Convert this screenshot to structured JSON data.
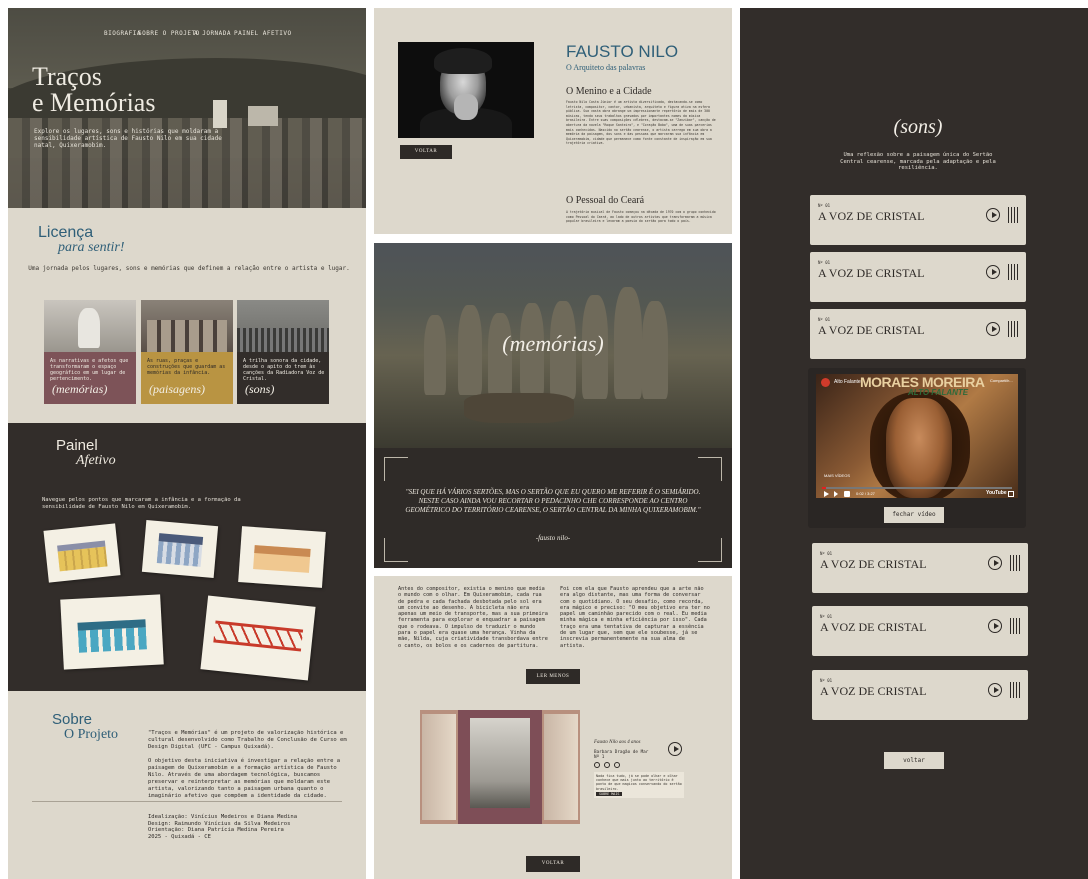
{
  "panel1": {
    "nav": [
      "BIOGRAFIA",
      "SOBRE O PROJETO",
      "A JORNADA",
      "PAINEL AFETIVO"
    ],
    "hero": {
      "title_line1": "Traços",
      "title_line2": "e Memórias",
      "subtitle": "Explore os lugares, sons e histórias que moldaram a sensibilidade artística de Fausto Nilo em sua cidade natal, Quixeramobim."
    },
    "licenca": {
      "title": "Licença",
      "subtitle": "para sentir!",
      "description": "Uma jornada pelos lugares, sons e memórias que definem a relação entre o artista e lugar."
    },
    "cards": [
      {
        "text": "As narrativas e afetos que transformaram o espaço geográfico em um lugar de pertencimento.",
        "label": "(memórias)",
        "color": "#7d5358"
      },
      {
        "text": "As ruas, praças e construções que guardam as memórias da infância.",
        "label": "(paisagens)",
        "color": "#b99442"
      },
      {
        "text": "A trilha sonora da cidade, desde o apito do trem às canções da Radiadora Voz de Cristal.",
        "label": "(sons)",
        "color": "#322d2a"
      }
    ],
    "painel": {
      "title": "Painel",
      "subtitle": "Afetivo",
      "description": "Navegue pelos pontos que marcaram a infância e a formação da sensibilidade de Fausto Nilo em Quixeramobim."
    },
    "sobre": {
      "title": "Sobre",
      "subtitle": "O Projeto",
      "paragraph1": "\"Traços e Memórias\" é um projeto de valorização histórica e cultural desenvolvido como Trabalho de Conclusão de Curso em Design Digital (UFC - Campus Quixadá).",
      "paragraph2": "O objetivo desta iniciativa é investigar a relação entre a paisagem de Quixeramobim e a formação artística de Fausto Nilo. Através de uma abordagem tecnológica, buscamos preservar e reinterpretar as memórias que moldaram este artista, valorizando tanto a paisagem urbana quanto o imaginário afetivo que compõem a identidade da cidade."
    },
    "credits": {
      "line1": "Idealização: Vinícius Medeiros e Diana Medina",
      "line2": "Design: Raimundo Vinícius da Silva Medeiros",
      "line3": "Orientação: Diana Patrícia Medina Pereira",
      "line4": "2025 - Quixadá - CE"
    }
  },
  "panel2": {
    "bio": {
      "name": "FAUSTO NILO",
      "role": "O Arquiteto das palavras",
      "back_label": "VOLTAR",
      "section1_title": "O Menino e a Cidade",
      "section1_text": "Fausto Nilo Costa Júnior é um artista diversificado, destacando-se como letrista, compositor, cantor, urbanista, arquiteto e figura ativa na esfera pública. Sua vasta obra abrange um impressionante repertório de mais de 300 músicas, tendo seus trabalhos gravados por importantes nomes da música brasileira. Entre suas composições célebres, destacam-se \"Zanzibar\", canção de abertura da novela \"Roque Santeiro\", e \"Coração Bobo\", uma de suas parcerias mais conhecidas. Nascido no sertão cearense, o artista carrega em sua obra a memória da paisagem, dos sons e das pessoas que marcaram sua infância em Quixeramobim, cidade que permanece como fonte constante de inspiração em sua trajetória criativa.",
      "section2_title": "O Pessoal do Ceará",
      "section2_text": "A trajetória musical de Fausto começou na década de 1970 com o grupo conhecido como Pessoal do Ceará, ao lado de outros artistas que transformaram a música popular brasileira e levaram a poesia do sertão para todo o país."
    },
    "memorias": {
      "title": "(memórias)",
      "quote": "\"SEI QUE HÁ VÁRIOS SERTÕES, MAS O SERTÃO QUE EU QUERO ME REFERIR É O SEMIÁRIDO. NESTE CASO AINDA VOU RECORTAR O PEDACINHO CHE CORRESPONDE AO CENTRO GEOMÉTRICO DO TERRITÓRIO CEARENSE, O SERTÃO CENTRAL DA MINHA QUIXERAMOBIM.\"",
      "author": "-fausto nilo-"
    },
    "texts": {
      "col1": "Antes do compositor, existia o menino que media o mundo com o olhar. Em Quixeramobim, cada rua de pedra e cada fachada desbotada pelo sol era um convite ao desenho. A bicicleta não era apenas um meio de transporte, mas a sua primeira ferramenta para explorar e enquadrar a paisagem que o rodeava. O impulso de traduzir o mundo para o papel era quase uma herança. Vinha da mãe, Nilda, cuja criatividade transbordava entre o canto, os bolos e os cadernos de partitura.",
      "col2": "Foi com ela que Fausto aprendeu que a arte não era algo distante, mas uma forma de conversar com o quotidiano. O seu desafio, como recorda, era mágico e preciso: \"O meu objetivo era ter no papel um caminhão parecido com o real. Eu media minha mágica e minha eficiência por isso\". Cada traço era uma tentativa de capturar a essência de um lugar que, sem que ele soubesse, já se inscrevia permanentemente na sua alma de artista.",
      "read_less": "LER MENOS",
      "back_label": "VOLTAR"
    },
    "player": {
      "title": "Fausto Nilo aos 4 anos",
      "subtitle": "Barbara Dragão de Mar",
      "track": "Nº 1",
      "note": "Nada fica tudo, já se pode olhar e olhar conhece que mais junto ao território é ponto de que magicos conservando do sertão brasileiro.",
      "note_button": "SOBRE MAIS"
    }
  },
  "panel3": {
    "title": "(sons)",
    "subtitle": "Uma reflexão sobre a paisagem única do Sertão Central cearense, marcada pela adaptação e pela resiliência.",
    "tracks": [
      {
        "number": "Nº 01",
        "name": "A VOZ DE CRISTAL"
      },
      {
        "number": "Nº 01",
        "name": "A VOZ DE CRISTAL"
      },
      {
        "number": "Nº 01",
        "name": "A VOZ DE CRISTAL"
      },
      {
        "number": "Nº 01",
        "name": "A VOZ DE CRISTAL"
      },
      {
        "number": "Nº 01",
        "name": "A VOZ DE CRISTAL"
      },
      {
        "number": "Nº 01",
        "name": "A VOZ DE CRISTAL"
      }
    ],
    "video": {
      "channel": "Alto Falante",
      "band": "MORAES MOREIRA",
      "band_sub": "ALTO FALANTE",
      "share": "Compartilh...",
      "more_videos": "MAIS VÍDEOS",
      "time": "0:02 / 3:27",
      "brand": "YouTube",
      "close_label": "fechar vídeo"
    },
    "back_label": "voltar"
  },
  "colors": {
    "beige": "#ddd8cc",
    "dark": "#322d2a",
    "blue": "#2f5f78",
    "wine": "#7d5358",
    "ochre": "#b99442"
  }
}
